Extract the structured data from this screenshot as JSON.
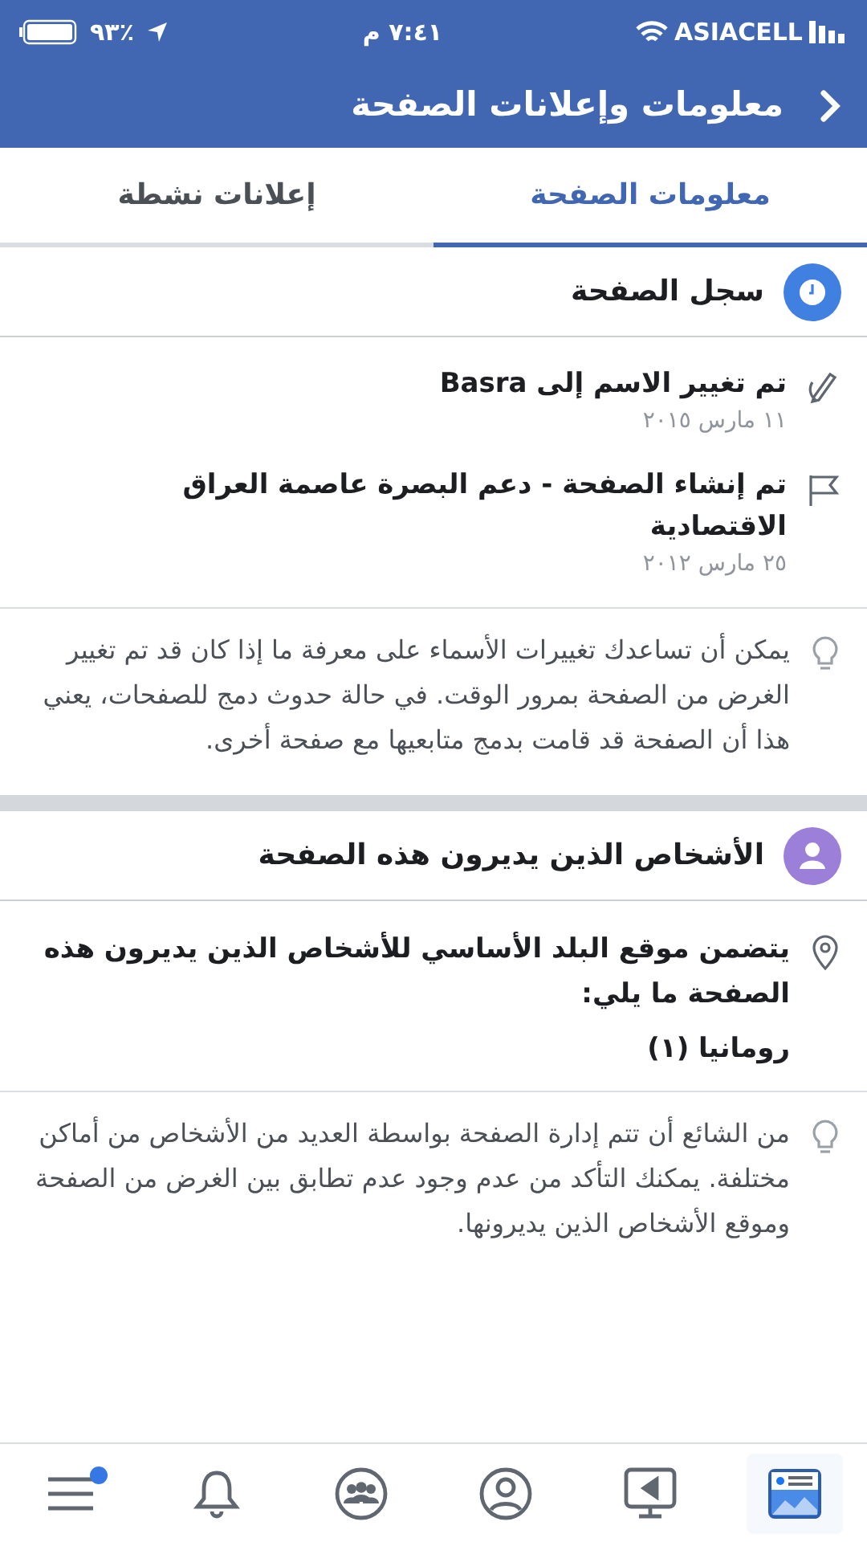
{
  "status_bar": {
    "carrier": "ASIACELL",
    "time": "٧:٤١ م",
    "battery": "٪٩٣"
  },
  "header": {
    "title": "معلومات وإعلانات الصفحة"
  },
  "tabs": [
    {
      "label": "معلومات الصفحة",
      "selected": true
    },
    {
      "label": "إعلانات نشطة",
      "selected": false
    }
  ],
  "history": {
    "title": "سجل الصفحة",
    "events": [
      {
        "kind": "rename",
        "text": "تم تغيير الاسم إلى Basra",
        "date": "١١ مارس ٢٠١٥"
      },
      {
        "kind": "created",
        "text": "تم إنشاء الصفحة - دعم البصرة عاصمة العراق الاقتصادية",
        "date": "٢٥ مارس ٢٠١٢"
      }
    ],
    "tip": "يمكن أن تساعدك تغييرات الأسماء على معرفة ما إذا كان قد تم تغيير الغرض من الصفحة بمرور الوقت. في حالة حدوث دمج للصفحات، يعني هذا أن الصفحة قد قامت بدمج متابعيها مع صفحة أخرى."
  },
  "managers": {
    "title": "الأشخاص الذين يديرون هذه الصفحة",
    "location_text": "يتضمن موقع البلد الأساسي للأشخاص الذين يديرون هذه الصفحة ما يلي:",
    "countries": [
      "رومانيا (١)"
    ],
    "tip": "من الشائع أن تتم إدارة الصفحة بواسطة العديد من الأشخاص من أماكن مختلفة. يمكنك التأكد من عدم وجود عدم تطابق بين الغرض من الصفحة وموقع الأشخاص الذين يديرونها."
  },
  "bottom_nav": [
    {
      "kind": "feed",
      "selected": true,
      "badge": false
    },
    {
      "kind": "video",
      "selected": false,
      "badge": false
    },
    {
      "kind": "profile",
      "selected": false,
      "badge": false
    },
    {
      "kind": "groups",
      "selected": false,
      "badge": false
    },
    {
      "kind": "notifications",
      "selected": false,
      "badge": false
    },
    {
      "kind": "menu",
      "selected": false,
      "badge": true
    }
  ]
}
